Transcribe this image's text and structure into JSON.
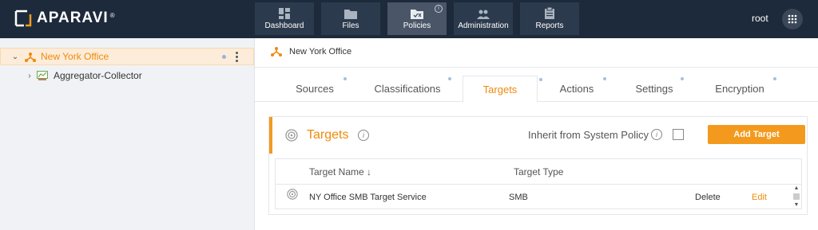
{
  "app": {
    "logo_text": "APARAVI",
    "logo_reg": "®",
    "user": "root"
  },
  "nav": [
    {
      "label": "Dashboard",
      "icon": "dashboard-icon"
    },
    {
      "label": "Files",
      "icon": "folder-icon"
    },
    {
      "label": "Policies",
      "icon": "policies-icon",
      "active": true
    },
    {
      "label": "Administration",
      "icon": "users-icon"
    },
    {
      "label": "Reports",
      "icon": "clipboard-icon"
    }
  ],
  "sidebar": {
    "items": [
      {
        "label": "New York Office",
        "selected": true
      },
      {
        "label": "Aggregator-Collector"
      }
    ]
  },
  "breadcrumb": {
    "label": "New York Office"
  },
  "tabs": [
    {
      "label": "Sources"
    },
    {
      "label": "Classifications"
    },
    {
      "label": "Targets",
      "active": true
    },
    {
      "label": "Actions"
    },
    {
      "label": "Settings"
    },
    {
      "label": "Encryption"
    }
  ],
  "card": {
    "title": "Targets",
    "inherit_label": "Inherit from System Policy",
    "inherit_checked": false,
    "add_button": "Add Target"
  },
  "table": {
    "columns": [
      "Target Name ↓",
      "Target Type"
    ],
    "rows": [
      {
        "name": "NY Office SMB Target Service",
        "type": "SMB",
        "delete": "Delete",
        "edit": "Edit"
      }
    ]
  },
  "colors": {
    "accent": "#f39a1e",
    "topbar": "#1d2a3b",
    "sidebar": "#f0f2f5"
  }
}
